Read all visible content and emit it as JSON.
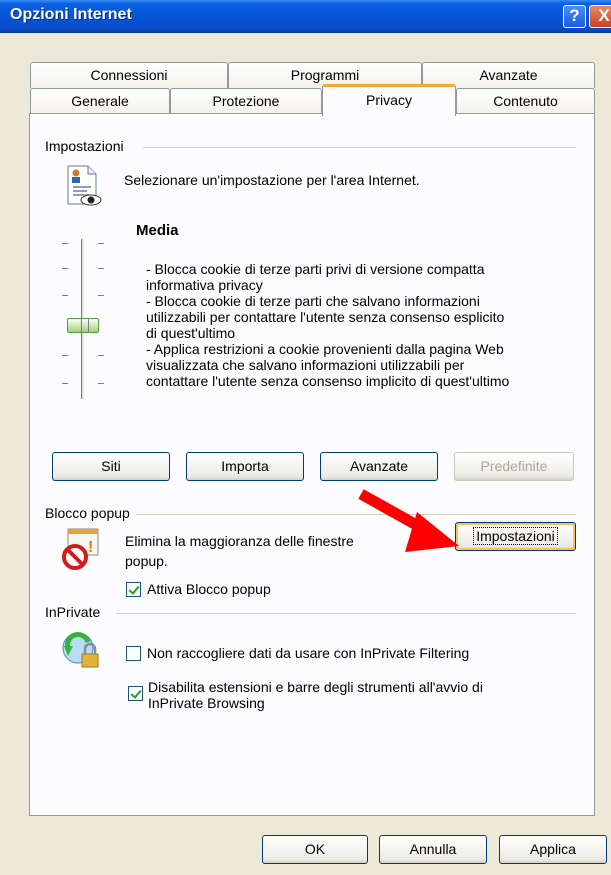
{
  "window": {
    "title": "Opzioni Internet",
    "help_glyph": "?",
    "close_glyph": "X"
  },
  "tabs": {
    "row1": [
      "Connessioni",
      "Programmi",
      "Avanzate"
    ],
    "row2": [
      "Generale",
      "Protezione",
      "Privacy",
      "Contenuto"
    ],
    "active": "Privacy"
  },
  "privacy": {
    "settings_label": "Impostazioni",
    "intro": "Selezionare un'impostazione per l'area Internet.",
    "level_title": "Media",
    "level_lines": [
      "- Blocca cookie di terze parti privi di versione compatta",
      "informativa privacy",
      "- Blocca cookie di terze parti che salvano informazioni",
      "utilizzabili per contattare l'utente senza consenso esplicito",
      "di quest'ultimo",
      "- Applica restrizioni a cookie provenienti dalla pagina Web",
      "visualizzata che salvano informazioni utilizzabili per",
      "contattare l'utente senza consenso implicito di quest'ultimo"
    ],
    "buttons": {
      "sites": "Siti",
      "import": "Importa",
      "advanced": "Avanzate",
      "default": "Predefinite"
    },
    "slider_level": "Media"
  },
  "popup": {
    "label": "Blocco popup",
    "desc_line1": "Elimina la maggioranza delle finestre",
    "desc_line2": "popup.",
    "settings_button": "Impostazioni",
    "enable_label": "Attiva Blocco popup",
    "enable_checked": true
  },
  "inprivate": {
    "label": "InPrivate",
    "filter_label": "Non raccogliere dati da usare con InPrivate Filtering",
    "filter_checked": false,
    "disable_line1": "Disabilita estensioni e barre degli strumenti all'avvio di",
    "disable_line2": "InPrivate Browsing",
    "disable_checked": true
  },
  "footer": {
    "ok": "OK",
    "cancel": "Annulla",
    "apply": "Applica"
  },
  "colors": {
    "arrow": "#ff0000",
    "titlebar": "#0856d8",
    "tab_highlight": "#f4a830"
  }
}
